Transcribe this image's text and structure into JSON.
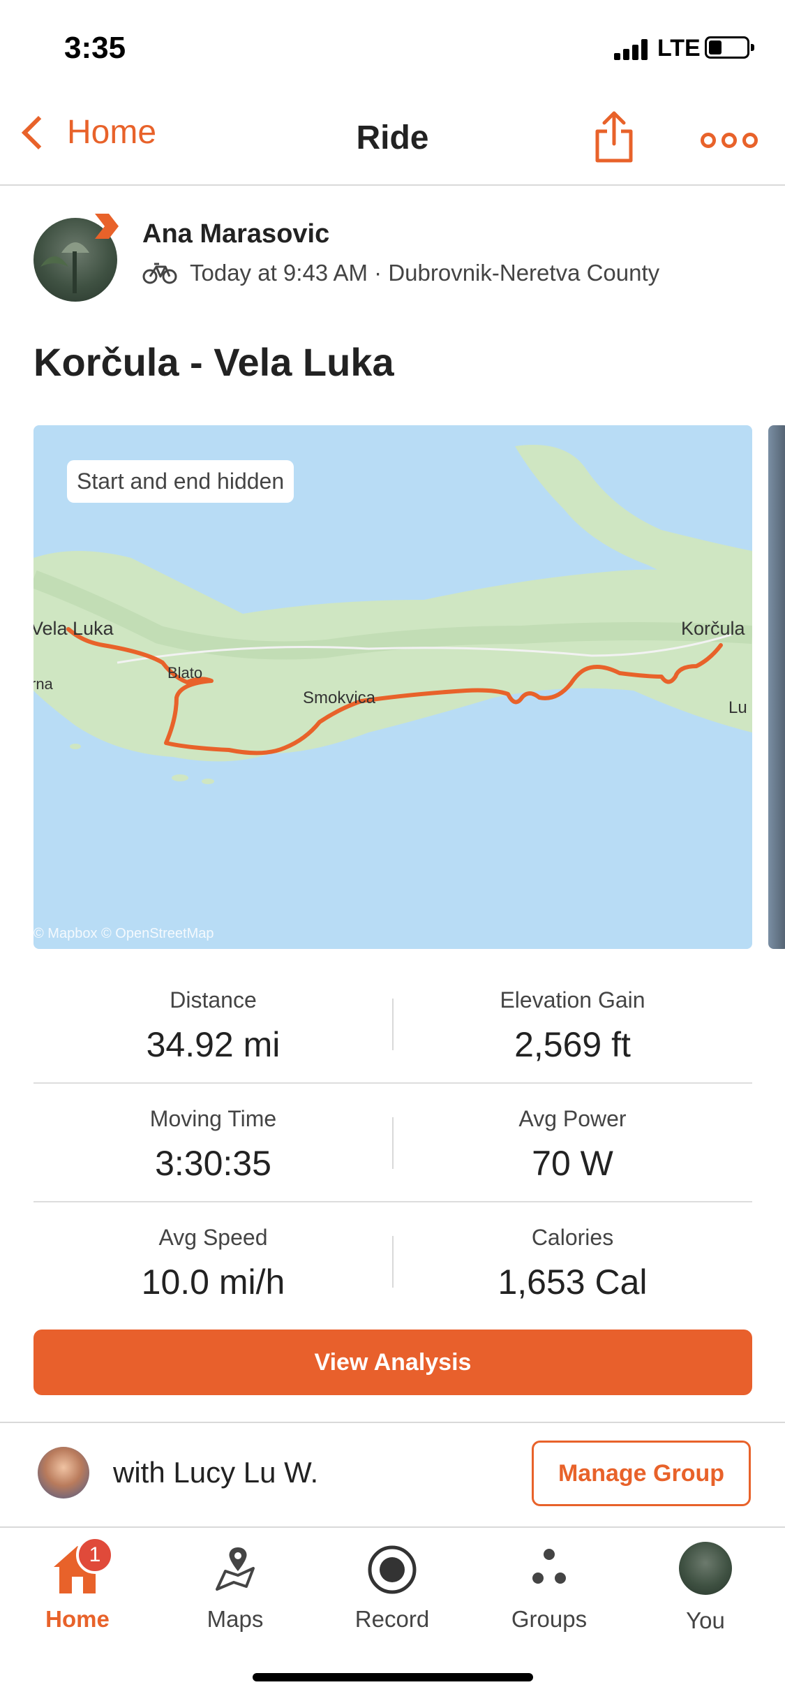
{
  "status_bar": {
    "time": "3:35",
    "network": "LTE"
  },
  "nav": {
    "back_label": "Home",
    "title": "Ride"
  },
  "athlete": {
    "name": "Ana Marasovic",
    "meta": "Today at 9:43 AM · Dubrovnik-Neretva County"
  },
  "activity": {
    "title": "Korčula - Vela Luka"
  },
  "map": {
    "pill": "Start and end hidden",
    "attribution": "© Mapbox © OpenStreetMap",
    "place_labels": [
      "Vela Luka",
      "Blato",
      "Smokvica",
      "Korčula",
      "rna",
      "Lu"
    ],
    "route_color": "#e8622a"
  },
  "stats": [
    {
      "left": {
        "label": "Distance",
        "value": "34.92 mi"
      },
      "right": {
        "label": "Elevation Gain",
        "value": "2,569 ft"
      }
    },
    {
      "left": {
        "label": "Moving Time",
        "value": "3:30:35"
      },
      "right": {
        "label": "Avg Power",
        "value": "70 W"
      }
    },
    {
      "left": {
        "label": "Avg Speed",
        "value": "10.0 mi/h"
      },
      "right": {
        "label": "Calories",
        "value": "1,653 Cal"
      }
    }
  ],
  "actions": {
    "view_analysis": "View Analysis",
    "manage_group": "Manage Group"
  },
  "group": {
    "with_text": "with Lucy Lu W."
  },
  "tabs": [
    {
      "label": "Home",
      "icon": "home-icon",
      "badge": "1"
    },
    {
      "label": "Maps",
      "icon": "maps-icon"
    },
    {
      "label": "Record",
      "icon": "record-icon"
    },
    {
      "label": "Groups",
      "icon": "groups-icon"
    },
    {
      "label": "You",
      "icon": "profile-avatar"
    }
  ],
  "colors": {
    "accent": "#e8622a",
    "button": "#e8602c",
    "badge": "#e04a3a",
    "water": "#b8dcf5",
    "land": "#cfe6c2"
  }
}
